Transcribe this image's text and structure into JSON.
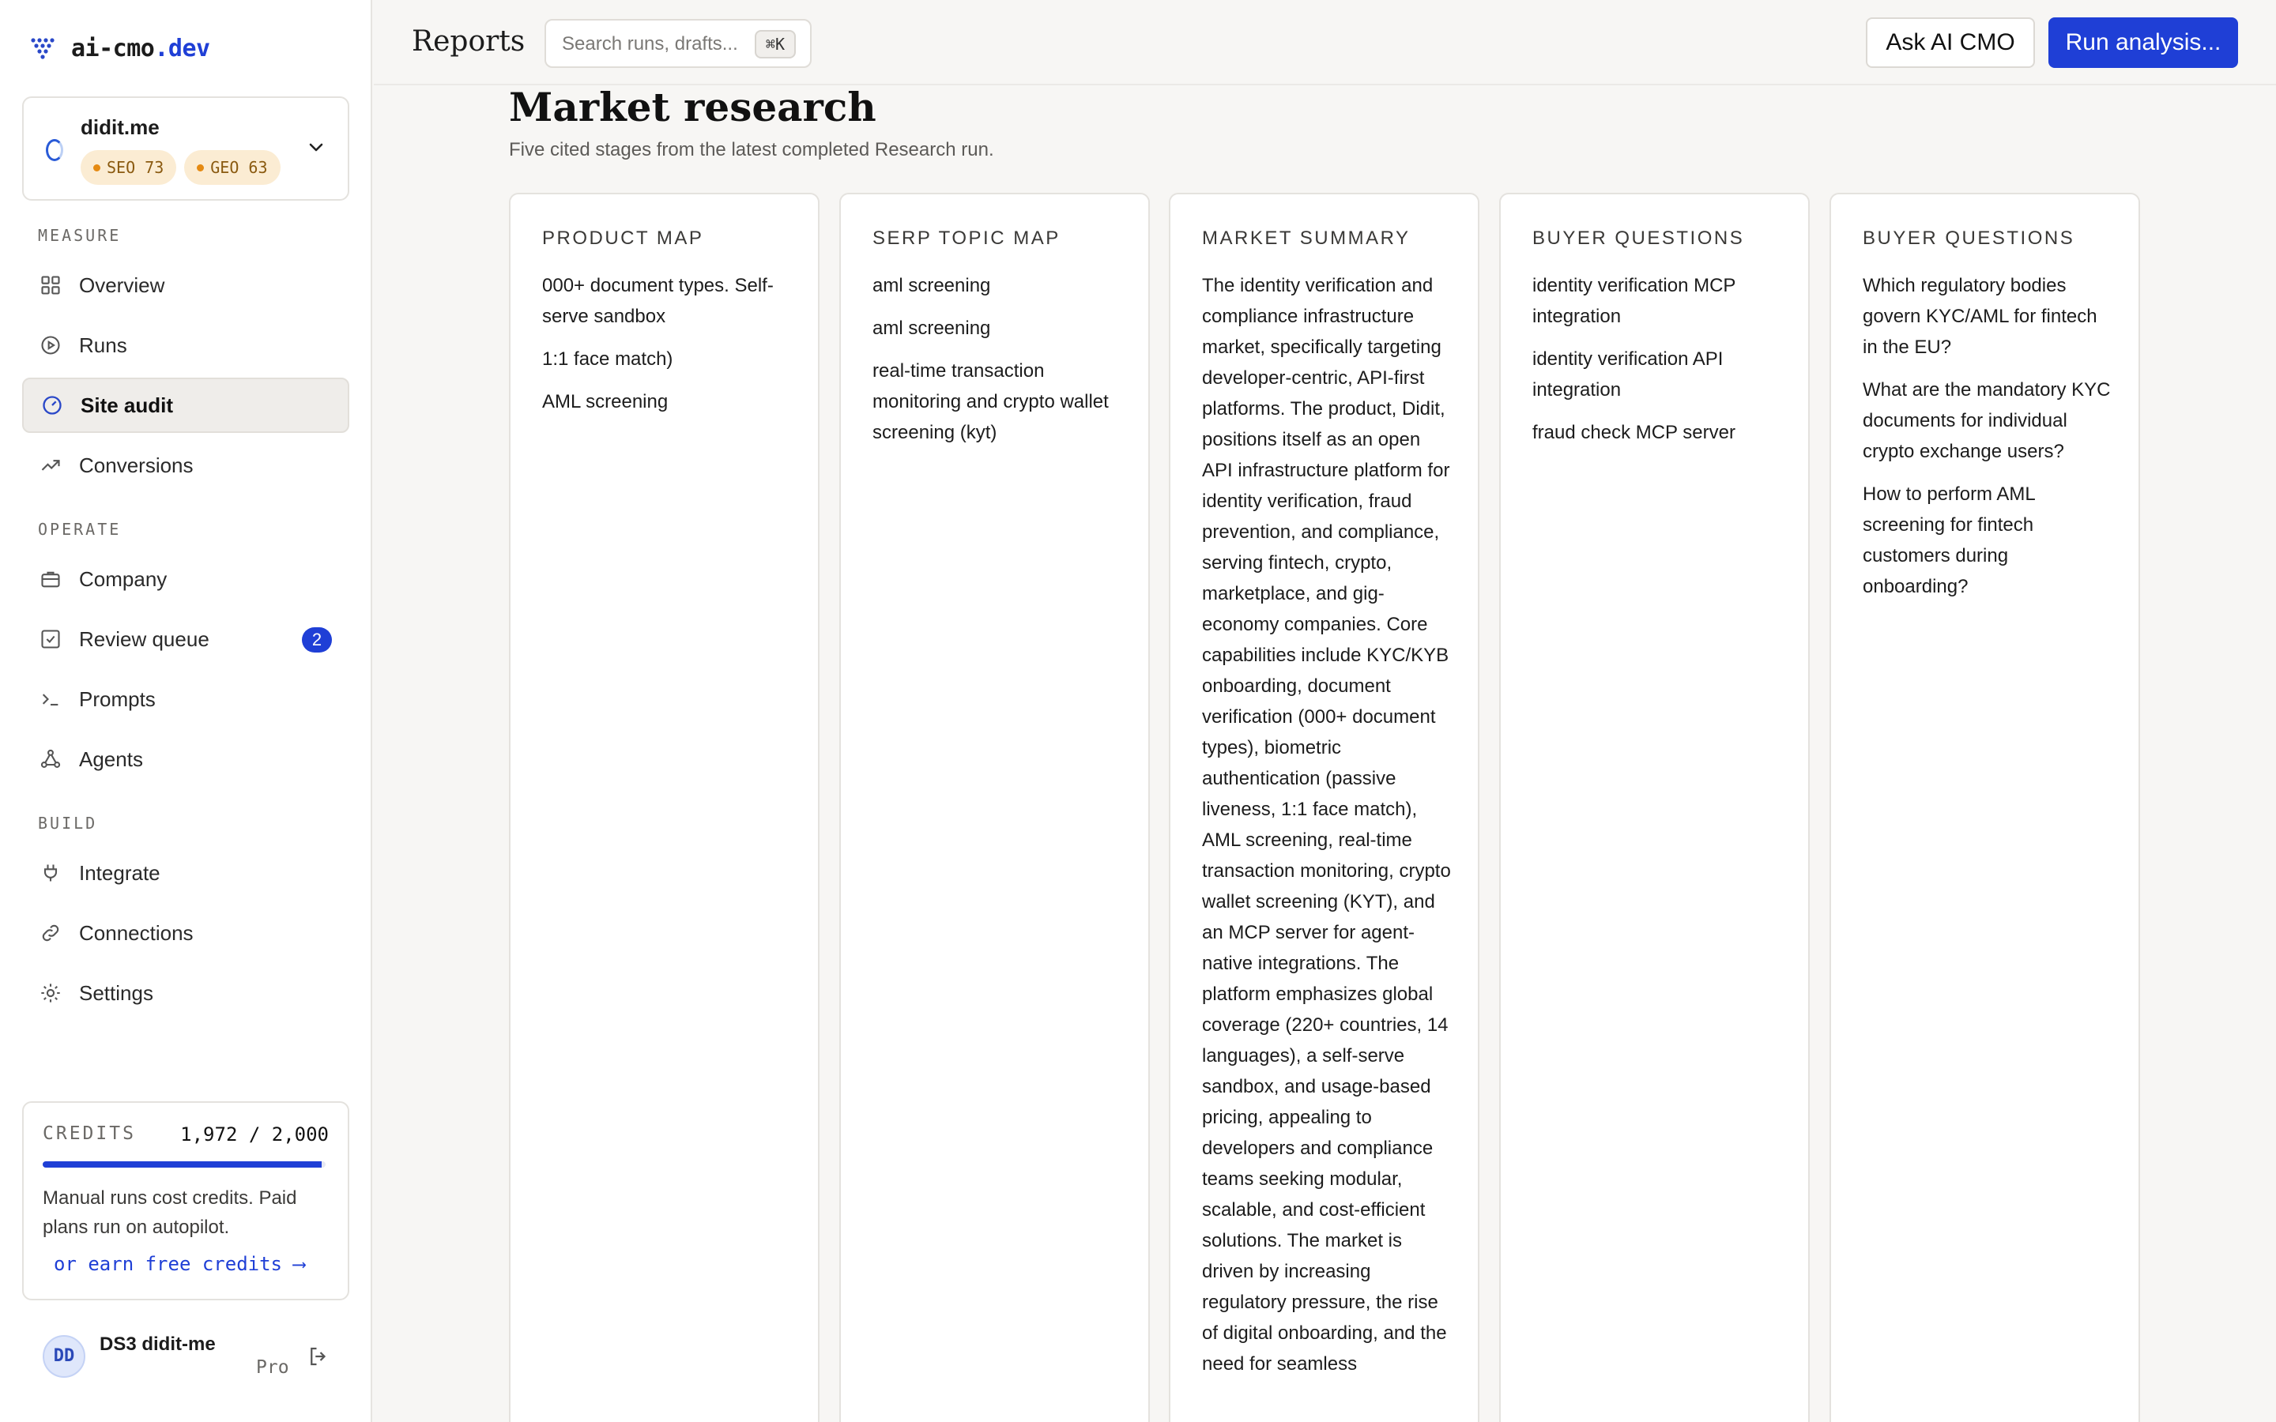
{
  "brand": {
    "name_prefix": "ai-cmo",
    "name_suffix": ".dev"
  },
  "project": {
    "name": "didit.me",
    "badges": [
      {
        "label": "SEO 73"
      },
      {
        "label": "GEO 63"
      }
    ]
  },
  "sidebar": {
    "sections": [
      {
        "label": "MEASURE"
      },
      {
        "label": "OPERATE"
      },
      {
        "label": "BUILD"
      }
    ],
    "items": [
      {
        "label": "Overview",
        "icon": "grid-icon"
      },
      {
        "label": "Runs",
        "icon": "play-circle-icon"
      },
      {
        "label": "Site audit",
        "icon": "gauge-icon",
        "active": true
      },
      {
        "label": "Conversions",
        "icon": "trending-up-icon"
      },
      {
        "label": "Company",
        "icon": "briefcase-icon"
      },
      {
        "label": "Review queue",
        "icon": "check-square-icon",
        "count": "2"
      },
      {
        "label": "Prompts",
        "icon": "terminal-icon"
      },
      {
        "label": "Agents",
        "icon": "network-icon"
      },
      {
        "label": "Integrate",
        "icon": "plug-icon"
      },
      {
        "label": "Connections",
        "icon": "link-icon"
      },
      {
        "label": "Settings",
        "icon": "gear-icon"
      }
    ]
  },
  "credits": {
    "label": "CREDITS",
    "value": "1,972 / 2,000",
    "used_fraction": 0.986,
    "note": "Manual runs cost credits. Paid plans run on autopilot.",
    "link": "or earn free credits ⟶"
  },
  "user": {
    "initials": "DD",
    "name": "DS3 didit-me",
    "plan": "Pro"
  },
  "topbar": {
    "title": "Reports",
    "search_placeholder": "Search runs, drafts...",
    "shortcut": "⌘K",
    "ask_button": "Ask AI CMO",
    "run_button": "Run analysis..."
  },
  "main": {
    "title": "Market research",
    "subtitle": "Five cited stages from the latest completed Research run.",
    "cards": [
      {
        "title": "PRODUCT MAP",
        "items": [
          "000+ document types. Self-serve sandbox",
          "1:1 face match)",
          "AML screening"
        ]
      },
      {
        "title": "SERP TOPIC MAP",
        "items": [
          "aml screening",
          "aml screening",
          "real-time transaction monitoring and crypto wallet screening (kyt)"
        ]
      },
      {
        "title": "MARKET SUMMARY",
        "text": "The identity verification and compliance infrastructure market, specifically targeting developer-centric, API-first platforms. The product, Didit, positions itself as an open API infrastructure platform for identity verification, fraud prevention, and compliance, serving fintech, crypto, marketplace, and gig-economy companies. Core capabilities include KYC/KYB onboarding, document verification (000+ document types), biometric authentication (passive liveness, 1:1 face match), AML screening, real-time transaction monitoring, crypto wallet screening (KYT), and an MCP server for agent-native integrations. The platform emphasizes global coverage (220+ countries, 14 languages), a self-serve sandbox, and usage-based pricing, appealing to developers and compliance teams seeking modular, scalable, and cost-efficient solutions. The market is driven by increasing regulatory pressure, the rise of digital onboarding, and the need for seamless"
      },
      {
        "title": "BUYER QUESTIONS",
        "items": [
          "identity verification MCP integration",
          "identity verification API integration",
          "fraud check MCP server"
        ]
      },
      {
        "title": "BUYER QUESTIONS",
        "items": [
          "Which regulatory bodies govern KYC/AML for fintech in the EU?",
          "What are the mandatory KYC documents for individual crypto exchange users?",
          "How to perform AML screening for fintech customers during onboarding?"
        ]
      }
    ]
  },
  "colors": {
    "accent": "#1f3fd6",
    "badge_bg": "#fbecd3",
    "badge_dot": "#e58a12"
  }
}
